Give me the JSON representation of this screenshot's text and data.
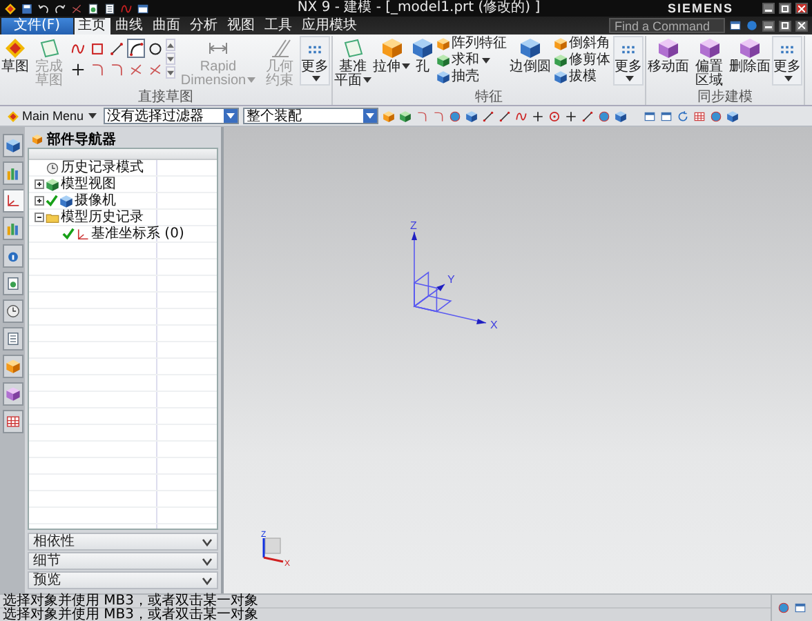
{
  "window": {
    "title": "NX 9 - 建模 - [_model1.prt (修改的) ]",
    "brand": "SIEMENS"
  },
  "file_menu": {
    "label": "文件(F)"
  },
  "menu_tabs": [
    {
      "label": "主页",
      "kind": "tab",
      "selected": true
    },
    {
      "label": "曲线",
      "kind": "tab",
      "selected": false
    },
    {
      "label": "曲面",
      "kind": "tab",
      "selected": false
    },
    {
      "label": "分析",
      "kind": "tab",
      "selected": false
    },
    {
      "label": "视图",
      "kind": "tab",
      "selected": false
    },
    {
      "label": "工具",
      "kind": "tab",
      "selected": false
    },
    {
      "label": "应用模块",
      "kind": "tab",
      "selected": false
    }
  ],
  "command_search": {
    "placeholder": "Find a Command"
  },
  "ribbon_groups": [
    {
      "title": "直接草图",
      "items": [
        {
          "kind": "large",
          "label": "草图",
          "disabled": false,
          "dropdown": false
        },
        {
          "kind": "large",
          "label": "完成草图",
          "disabled": true,
          "dropdown": false
        },
        {
          "kind": "tool_grid",
          "tools": [
            {
              "selected": false
            },
            {
              "selected": false
            },
            {
              "selected": false
            },
            {
              "selected": true
            },
            {
              "selected": false
            },
            {
              "selected": false
            },
            {
              "selected": false
            },
            {
              "selected": false
            },
            {
              "selected": false
            },
            {
              "selected": false
            }
          ]
        },
        {
          "kind": "large",
          "label": "Rapid Dimension",
          "disabled": true,
          "dropdown": true
        },
        {
          "kind": "large",
          "label": "几何约束",
          "disabled": true,
          "dropdown": false
        },
        {
          "kind": "more",
          "label": "更多"
        }
      ]
    },
    {
      "title": "特征",
      "items": [
        {
          "kind": "large",
          "label": "基准平面",
          "disabled": false,
          "dropdown": true
        },
        {
          "kind": "large",
          "label": "拉伸",
          "disabled": false,
          "dropdown": true
        },
        {
          "kind": "large",
          "label": "孔",
          "disabled": false,
          "dropdown": false
        },
        {
          "kind": "small_stack",
          "entries": [
            {
              "label": "阵列特征",
              "dropdown": false
            },
            {
              "label": "求和",
              "dropdown": true
            },
            {
              "label": "抽壳",
              "dropdown": false
            }
          ]
        },
        {
          "kind": "large",
          "label": "边倒圆",
          "disabled": false,
          "dropdown": false
        },
        {
          "kind": "small_stack",
          "entries": [
            {
              "label": "倒斜角",
              "dropdown": false
            },
            {
              "label": "修剪体",
              "dropdown": false
            },
            {
              "label": "拔模",
              "dropdown": false
            }
          ]
        },
        {
          "kind": "more",
          "label": "更多"
        }
      ]
    },
    {
      "title": "同步建模",
      "items": [
        {
          "kind": "large",
          "label": "移动面",
          "disabled": false,
          "dropdown": false
        },
        {
          "kind": "large",
          "label": "偏置区域",
          "disabled": false,
          "dropdown": false
        },
        {
          "kind": "large",
          "label": "删除面",
          "disabled": false,
          "dropdown": false
        },
        {
          "kind": "more",
          "label": "更多"
        }
      ]
    }
  ],
  "toolbar": {
    "main_menu": "Main Menu",
    "selection_filters": [
      {
        "value": "没有选择过滤器"
      },
      {
        "value": "整个装配"
      }
    ]
  },
  "resource_tabs": [
    {
      "selected": false
    },
    {
      "selected": false
    },
    {
      "selected": true
    },
    {
      "selected": false
    },
    {
      "selected": false
    },
    {
      "selected": false
    },
    {
      "selected": false
    },
    {
      "selected": false
    },
    {
      "selected": false
    },
    {
      "selected": false
    },
    {
      "selected": false
    }
  ],
  "part_navigator": {
    "title": "部件导航器",
    "tree": [
      {
        "label": "历史记录模式",
        "checked": false
      },
      {
        "label": "模型视图",
        "expanded": false,
        "checked": false
      },
      {
        "label": "摄像机",
        "expanded": false,
        "checked": true
      },
      {
        "label": "模型历史记录",
        "expanded": true,
        "checked": false,
        "children": [
          {
            "label": "基准坐标系 (0)",
            "checked": true
          }
        ]
      }
    ],
    "panels": [
      {
        "label": "相依性",
        "expanded": false
      },
      {
        "label": "细节",
        "expanded": false
      },
      {
        "label": "预览",
        "expanded": false
      }
    ]
  },
  "viewport": {
    "csys_axes": [
      "X",
      "Y",
      "Z"
    ],
    "triad_axes": [
      "Z",
      "X"
    ]
  },
  "status_lines": [
    "选择对象并使用 MB3，或者双击某一对象",
    "选择对象并使用 MB3，或者双击某一对象"
  ]
}
